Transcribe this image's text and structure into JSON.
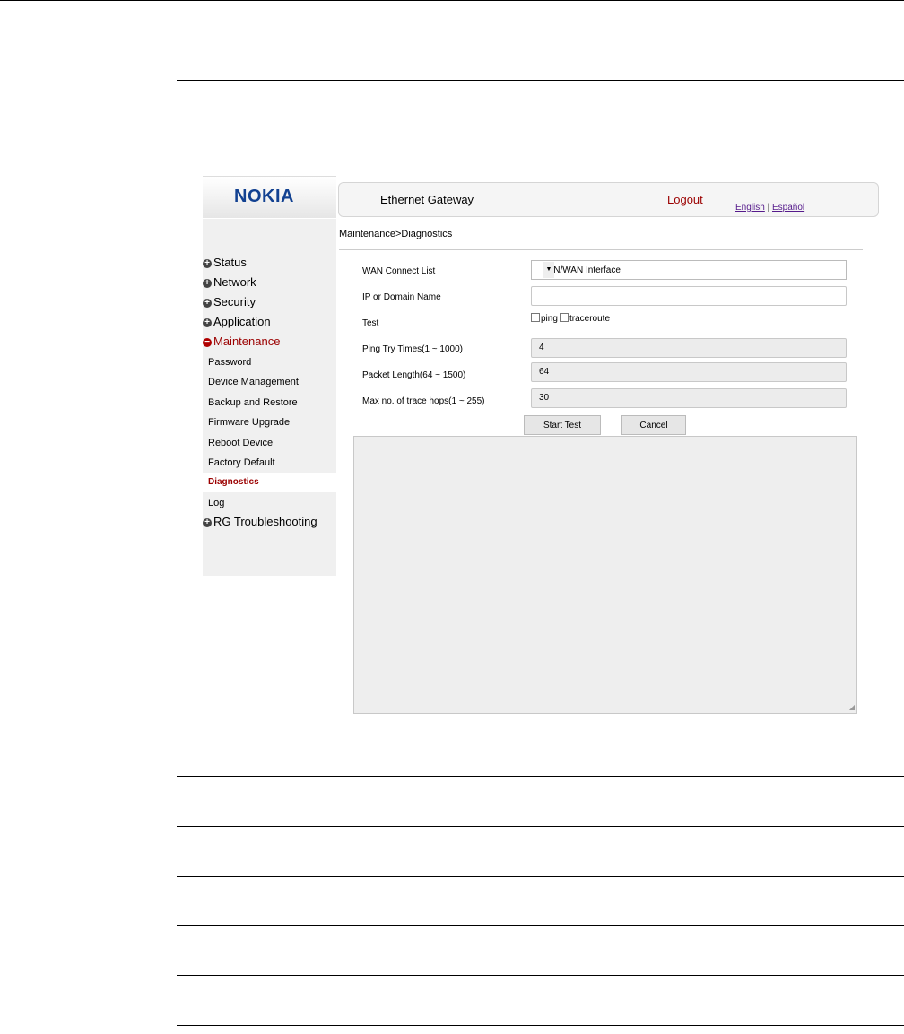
{
  "brand": {
    "logo": "NOKIA",
    "logo_color": "#124191"
  },
  "header": {
    "title": "Ethernet Gateway",
    "logout": "Logout",
    "lang_english": "English",
    "lang_sep": "|",
    "lang_spanish": "Español"
  },
  "breadcrumb": "Maintenance>Diagnostics",
  "sidebar": {
    "status": "Status",
    "network": "Network",
    "security": "Security",
    "application": "Application",
    "maintenance": "Maintenance",
    "sub": {
      "password": "Password",
      "device_management": "Device Management",
      "backup_restore": "Backup and Restore",
      "firmware_upgrade": "Firmware Upgrade",
      "reboot_device": "Reboot Device",
      "factory_default": "Factory Default",
      "diagnostics": "Diagnostics",
      "log": "Log"
    },
    "rg_troubleshooting": "RG Troubleshooting"
  },
  "form": {
    "wan_label": "WAN Connect List",
    "wan_value": "LAN/WAN Interface",
    "ip_label": "IP or Domain Name",
    "ip_value": "",
    "test_label": "Test",
    "ping_label": "ping",
    "traceroute_label": "traceroute",
    "ping_try_label": "Ping Try Times(1 ~ 1000)",
    "ping_try_value": "4",
    "packet_len_label": "Packet Length(64 ~ 1500)",
    "packet_len_value": "64",
    "max_hops_label": "Max no. of trace hops(1 ~ 255)",
    "max_hops_value": "30",
    "start_button": "Start Test",
    "cancel_button": "Cancel"
  },
  "colors": {
    "active": "#9b0000"
  }
}
